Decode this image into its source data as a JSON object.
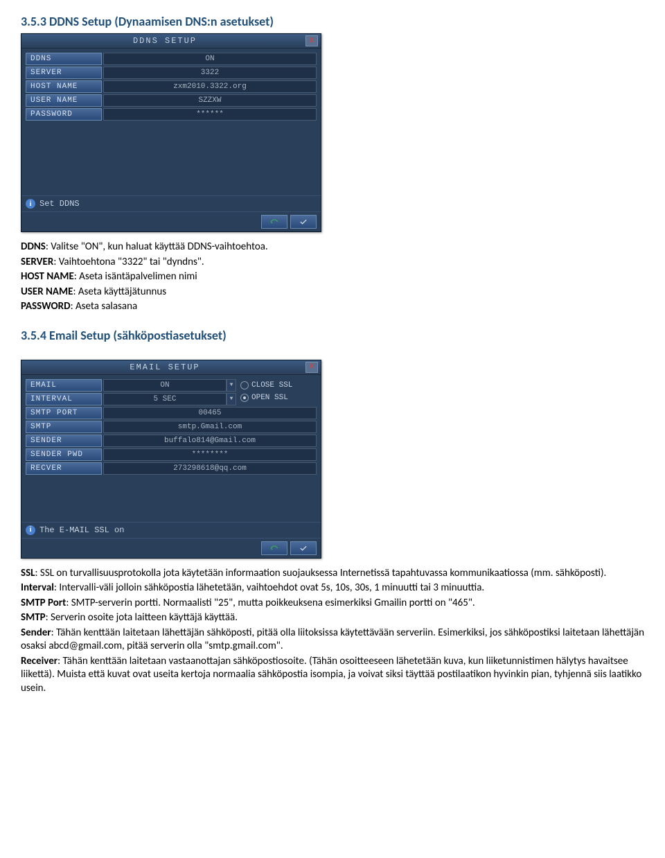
{
  "section1": {
    "heading": "3.5.3 DDNS Setup (Dynaamisen DNS:n asetukset)",
    "dialog": {
      "title": "DDNS SETUP",
      "rows": [
        {
          "label": "DDNS",
          "value": "ON"
        },
        {
          "label": "SERVER",
          "value": "3322"
        },
        {
          "label": "HOST NAME",
          "value": "zxm2010.3322.org"
        },
        {
          "label": "USER NAME",
          "value": "SZZXW"
        },
        {
          "label": "PASSWORD",
          "value": "******"
        }
      ],
      "status": "Set DDNS"
    },
    "body": [
      {
        "b": "DDNS",
        "t": ": Valitse \"ON\", kun haluat käyttää DDNS-vaihtoehtoa."
      },
      {
        "b": "SERVER",
        "t": ": Vaihtoehtona \"3322\" tai \"dyndns\"."
      },
      {
        "b": "HOST NAME",
        "t": ": Aseta isäntäpalvelimen nimi"
      },
      {
        "b": "USER NAME",
        "t": ": Aseta käyttäjätunnus"
      },
      {
        "b": "PASSWORD",
        "t": ": Aseta salasana"
      }
    ]
  },
  "section2": {
    "heading": "3.5.4 Email Setup (sähköpostiasetukset)",
    "dialog": {
      "title": "EMAIL SETUP",
      "email_label": "EMAIL",
      "email_value": "ON",
      "interval_label": "INTERVAL",
      "interval_value": "5 SEC",
      "radio1": "CLOSE SSL",
      "radio2": "OPEN SSL",
      "rows": [
        {
          "label": "SMTP PORT",
          "value": "00465"
        },
        {
          "label": "SMTP",
          "value": "smtp.Gmail.com"
        },
        {
          "label": "SENDER",
          "value": "buffalo814@Gmail.com"
        },
        {
          "label": "SENDER PWD",
          "value": "********"
        },
        {
          "label": "RECVER",
          "value": "273298618@qq.com"
        }
      ],
      "status": "The E-MAIL SSL on"
    },
    "body": [
      {
        "b": "SSL",
        "t": ": SSL on turvallisuusprotokolla jota käytetään informaation suojauksessa Internetissä tapahtuvassa kommunikaatiossa (mm. sähköposti)."
      },
      {
        "b": "Interval",
        "t": ": Intervalli-väli jolloin sähköpostia lähetetään, vaihtoehdot ovat  5s, 10s, 30s, 1 minuutti tai 3 minuuttia."
      },
      {
        "b": "SMTP Port",
        "t": ": SMTP-serverin portti. Normaalisti \"25\", mutta poikkeuksena esimerkiksi Gmailin portti on \"465\"."
      },
      {
        "b": "SMTP",
        "t": ": Serverin osoite jota laitteen käyttäjä käyttää."
      },
      {
        "b": "Sender",
        "t": ": Tähän kenttään laitetaan lähettäjän sähköposti, pitää olla liitoksissa käytettävään serveriin. Esimerkiksi, jos sähköpostiksi laitetaan lähettäjän osaksi abcd@gmail.com, pitää serverin olla \"smtp.gmail.com\"."
      },
      {
        "b": "Receiver",
        "t": ": Tähän kenttään laitetaan vastaanottajan sähköpostiosoite. (Tähän osoitteeseen lähetetään kuva, kun liiketunnistimen hälytys havaitsee liikettä). Muista että kuvat ovat useita kertoja normaalia sähköpostia isompia, ja voivat siksi täyttää postilaatikon hyvinkin pian, tyhjennä siis laatikko usein."
      }
    ]
  }
}
